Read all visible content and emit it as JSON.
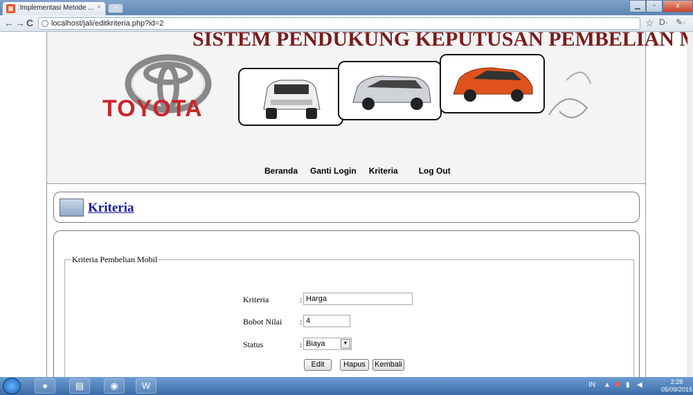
{
  "browser": {
    "tab_title": ":Implementasi Metode ...",
    "tab_close": "×",
    "new_tab": "+",
    "url": "localhost/jali/editkriteria.php?id=2",
    "win_minimize": "▁",
    "win_maximize": "▫",
    "win_close": "x",
    "back": "←",
    "forward": "→",
    "reload": "C",
    "star": "☆",
    "page_menu": "D·",
    "wrench": "✎·"
  },
  "header": {
    "banner_title": "SISTEM PENDUKUNG KEPUTUSAN PEMBELIAN MOBIL",
    "logo_text": "TOYOTA"
  },
  "nav": {
    "items": [
      {
        "label": "Beranda"
      },
      {
        "label": "Ganti Login"
      },
      {
        "label": "Kriteria"
      },
      {
        "label": "Log Out"
      }
    ]
  },
  "section": {
    "title": "Kriteria"
  },
  "form": {
    "legend": "Kriteria Pembelian Mobil",
    "fields": {
      "kriteria": {
        "label": "Kriteria",
        "value": "Harga"
      },
      "bobot": {
        "label": "Bobot Nilai",
        "value": "4"
      },
      "status": {
        "label": "Status",
        "value": "Biaya"
      }
    },
    "colon": ":",
    "buttons": {
      "edit": "Edit",
      "hapus": "Hapus",
      "kembali": "Kembali"
    }
  },
  "taskbar": {
    "tray_lang": "IN",
    "time": "2:28",
    "date": "05/09/2015"
  }
}
